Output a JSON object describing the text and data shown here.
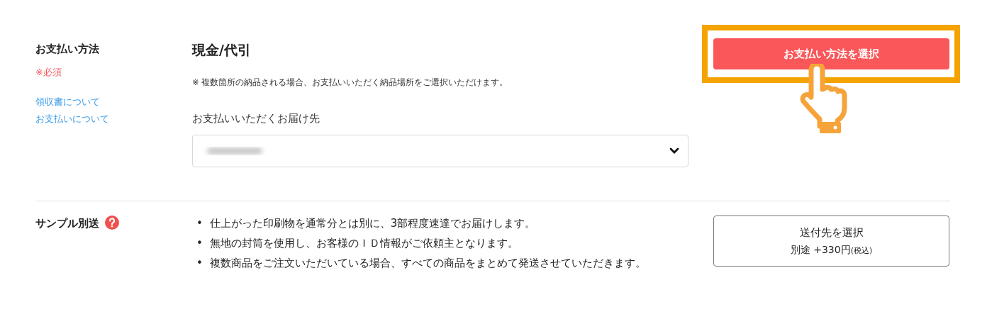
{
  "payment": {
    "label": "お支払い方法",
    "required": "※必須",
    "links": [
      "領収書について",
      "お支払いについて"
    ],
    "method": "現金/代引",
    "note": "※  複数箇所の納品される場合、お支払いいただく納品場所をご選択いただけます。",
    "destination_label": "お支払いいただくお届け先",
    "select_button": "お支払い方法を選択",
    "highlighted": true
  },
  "sample": {
    "label": "サンプル別送",
    "marker": "•",
    "bullets": [
      "仕上がった印刷物を通常分とは別に、3部程度速達でお届けします。",
      "無地の封筒を使用し、お客様のＩＤ情報がご依頼主となります。",
      "複数商品をご注文いただいている場合、すべての商品をまとめて発送させていただきます。"
    ],
    "button_title": "送付先を選択",
    "button_price": "別途 +330円",
    "button_tax": "(税込)"
  }
}
